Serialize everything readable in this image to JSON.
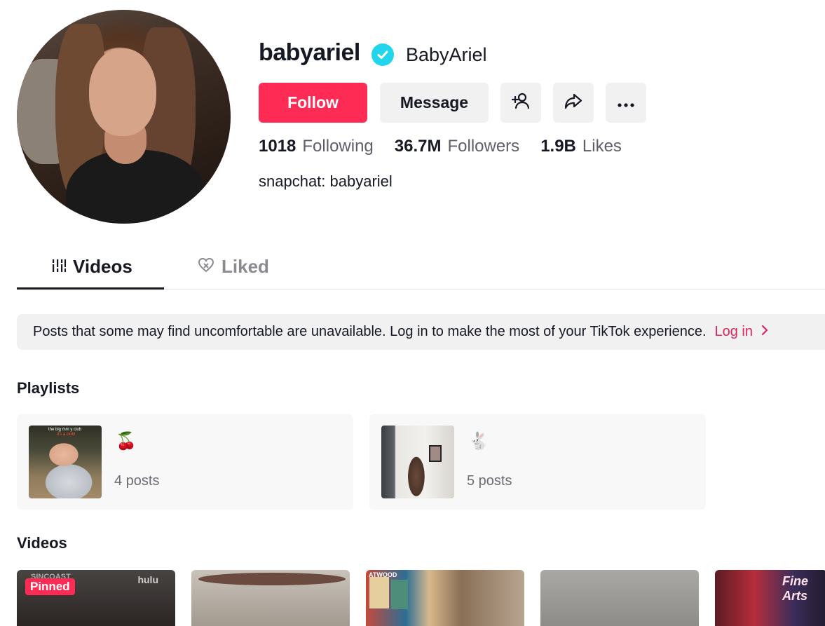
{
  "profile": {
    "username": "babyariel",
    "nickname": "BabyAriel",
    "bio": "snapchat: babyariel",
    "verified_color": "#20d5ec"
  },
  "actions": {
    "follow_label": "Follow",
    "message_label": "Message",
    "add_friend_icon": "add-user-icon",
    "share_icon": "share-icon",
    "more_icon": "more-icon"
  },
  "stats": [
    {
      "value": "1018",
      "label": "Following"
    },
    {
      "value": "36.7M",
      "label": "Followers"
    },
    {
      "value": "1.9B",
      "label": "Likes"
    }
  ],
  "tabs": [
    {
      "label": "Videos",
      "icon": "grid-icon",
      "active": true
    },
    {
      "label": "Liked",
      "icon": "liked-heart-icon",
      "active": false
    }
  ],
  "notice": {
    "text": "Posts that some may find uncomfortable are unavailable. Log in to make the most of your TikTok experience.",
    "link_label": "Log in"
  },
  "playlists": {
    "title": "Playlists",
    "items": [
      {
        "emoji": "🍒",
        "count": "4 posts",
        "thumb_caption_1": "the big mm y club",
        "thumb_caption_2": "it's a club!"
      },
      {
        "emoji": "🐇",
        "count": "5 posts"
      }
    ]
  },
  "videos": {
    "title": "Videos",
    "items": [
      {
        "badge": "Pinned",
        "overlay_brand": "hulu",
        "overlay_text": "SINCOAST"
      },
      {},
      {
        "overlay_text": "ATWOOD"
      },
      {},
      {
        "overlay_text": "Fine Arts"
      }
    ]
  },
  "colors": {
    "accent": "#fe2c55",
    "link": "#e0245e",
    "button_bg": "#f1f1f2"
  }
}
